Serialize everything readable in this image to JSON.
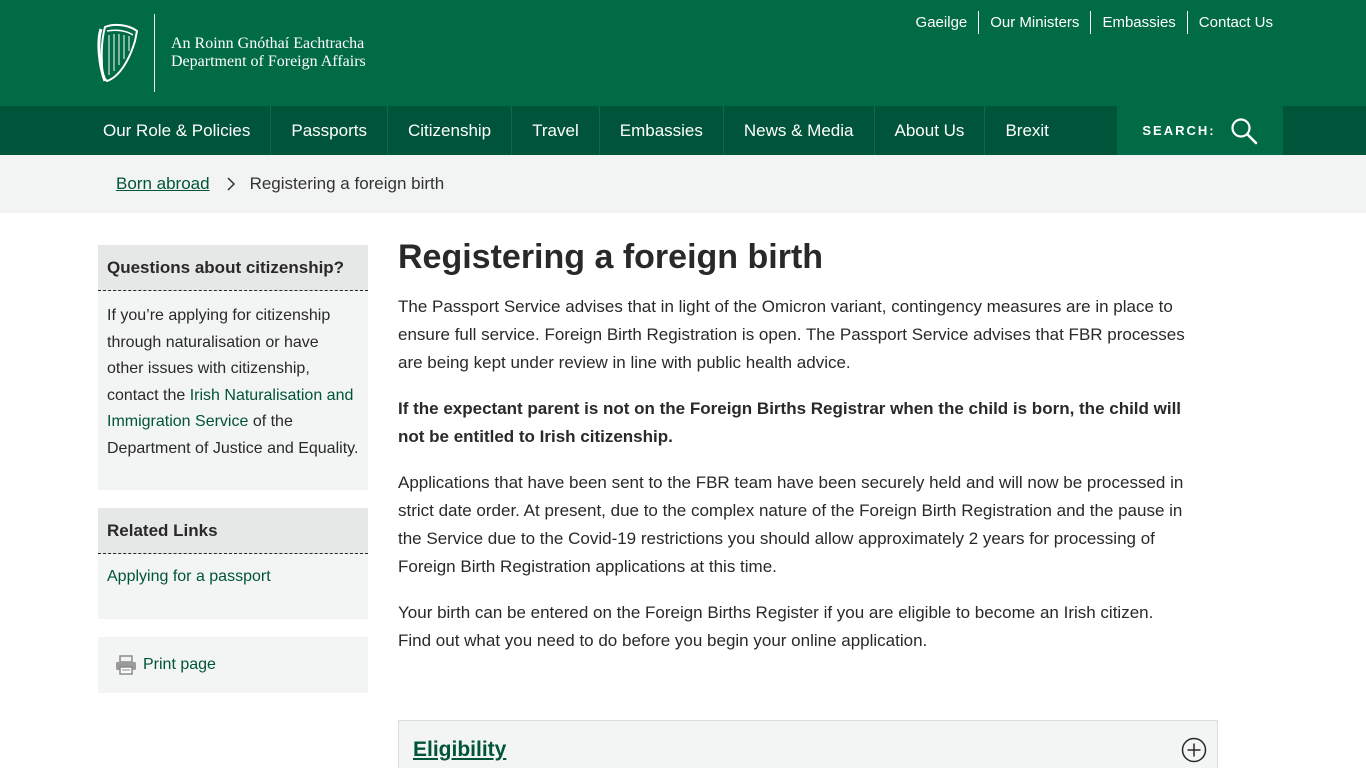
{
  "header": {
    "logo_line1": "An Roinn Gnóthaí Eachtracha",
    "logo_line2": "Department of Foreign Affairs",
    "toplinks": [
      "Gaeilge",
      "Our Ministers",
      "Embassies",
      "Contact Us"
    ]
  },
  "nav": {
    "items": [
      "Our Role & Policies",
      "Passports",
      "Citizenship",
      "Travel",
      "Embassies",
      "News & Media",
      "About Us",
      "Brexit"
    ],
    "search_label": "SEARCH:"
  },
  "breadcrumb": {
    "parent": "Born abroad",
    "current": "Registering a foreign birth"
  },
  "sidebar": {
    "citizenship_card": {
      "title": "Questions about citizenship?",
      "text_before": "If you’re applying for citizenship through naturalisation or have other issues with citizenship, contact the ",
      "link": "Irish Naturalisation and Immigration Service",
      "text_after": " of the Department of Justice and Equality."
    },
    "related_card": {
      "title": "Related Links",
      "link": "Applying for a passport"
    },
    "print_label": "Print page"
  },
  "main": {
    "title": "Registering a foreign birth",
    "paragraphs": [
      "The Passport Service advises that in light of the Omicron variant, contingency measures are in place to ensure full service. Foreign Birth Registration is open. The Passport Service advises that FBR processes are being kept under review in line with public health advice.",
      "If the expectant parent is not on the Foreign Births Registrar when the child is born, the child will not be entitled to Irish citizenship.",
      "Applications that have been sent to the FBR team have been securely held and will now be processed in strict date order. At present, due to the complex nature of the Foreign Birth Registration and the pause in the Service due to the Covid-19 restrictions you should allow approximately 2 years for processing of Foreign Birth Registration applications at this time.",
      "Your birth can be entered on the Foreign Births Register if you are eligible to become an Irish citizen. Find out what you need to do before you begin your online application."
    ],
    "accordion_title": "Eligibility"
  },
  "colors": {
    "header_green": "#006b45",
    "nav_green": "#00543a",
    "link_green": "#00543a"
  }
}
